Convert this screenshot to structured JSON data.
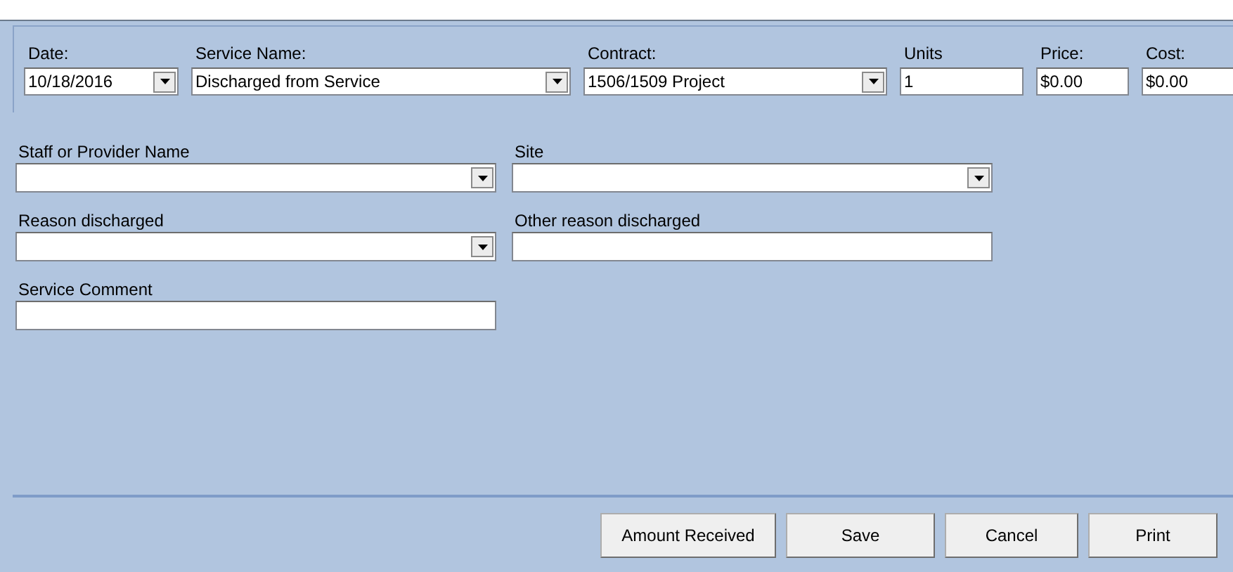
{
  "top_fields": [
    {
      "kind": "date",
      "label": "Date:",
      "value": "10/18/2016"
    },
    {
      "kind": "combo",
      "label": "Service Name:",
      "value": "Discharged from Service"
    },
    {
      "kind": "combo",
      "label": "Contract:",
      "value": "1506/1509 Project"
    },
    {
      "kind": "text",
      "label": "Units",
      "value": "1"
    },
    {
      "kind": "text",
      "label": "Price:",
      "value": "$0.00"
    },
    {
      "kind": "text",
      "label": "Cost:",
      "value": "$0.00"
    }
  ],
  "form_rows": [
    [
      {
        "kind": "combo",
        "label": "Staff or Provider Name"
      },
      {
        "kind": "combo",
        "label": "Site"
      }
    ],
    [
      {
        "kind": "combo",
        "label": "Reason discharged"
      },
      {
        "kind": "text",
        "label": "Other reason discharged"
      }
    ],
    [
      {
        "kind": "text",
        "label": "Service Comment"
      }
    ]
  ],
  "buttons": [
    "Amount Received",
    "Save",
    "Cancel",
    "Print"
  ]
}
